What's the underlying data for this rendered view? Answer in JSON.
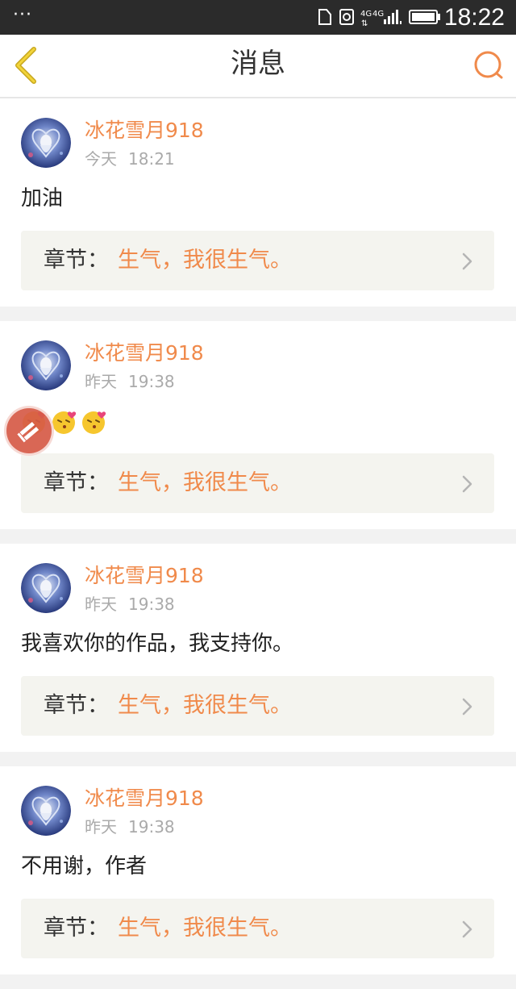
{
  "status_bar": {
    "dots": "···",
    "time": "18:22",
    "network": "4G 4G"
  },
  "header": {
    "title": "消息"
  },
  "colors": {
    "accent": "#f08a4b",
    "status_bar_bg": "#2b2b2b",
    "chapter_bg": "#f4f4ef"
  },
  "messages": [
    {
      "username": "冰花雪月918",
      "day": "今天",
      "time": "18:21",
      "text": "加油",
      "chapter_label": "章节：",
      "chapter_name": "生气，我很生气。"
    },
    {
      "username": "冰花雪月918",
      "day": "昨天",
      "time": "19:38",
      "text": "",
      "emojis": [
        "kiss-emoji",
        "kiss-emoji",
        "kiss-emoji"
      ],
      "chapter_label": "章节：",
      "chapter_name": "生气，我很生气。"
    },
    {
      "username": "冰花雪月918",
      "day": "昨天",
      "time": "19:38",
      "text": "我喜欢你的作品，我支持你。",
      "chapter_label": "章节：",
      "chapter_name": "生气，我很生气。"
    },
    {
      "username": "冰花雪月918",
      "day": "昨天",
      "time": "19:38",
      "text": "不用谢，作者",
      "chapter_label": "章节：",
      "chapter_name": "生气，我很生气。"
    }
  ]
}
